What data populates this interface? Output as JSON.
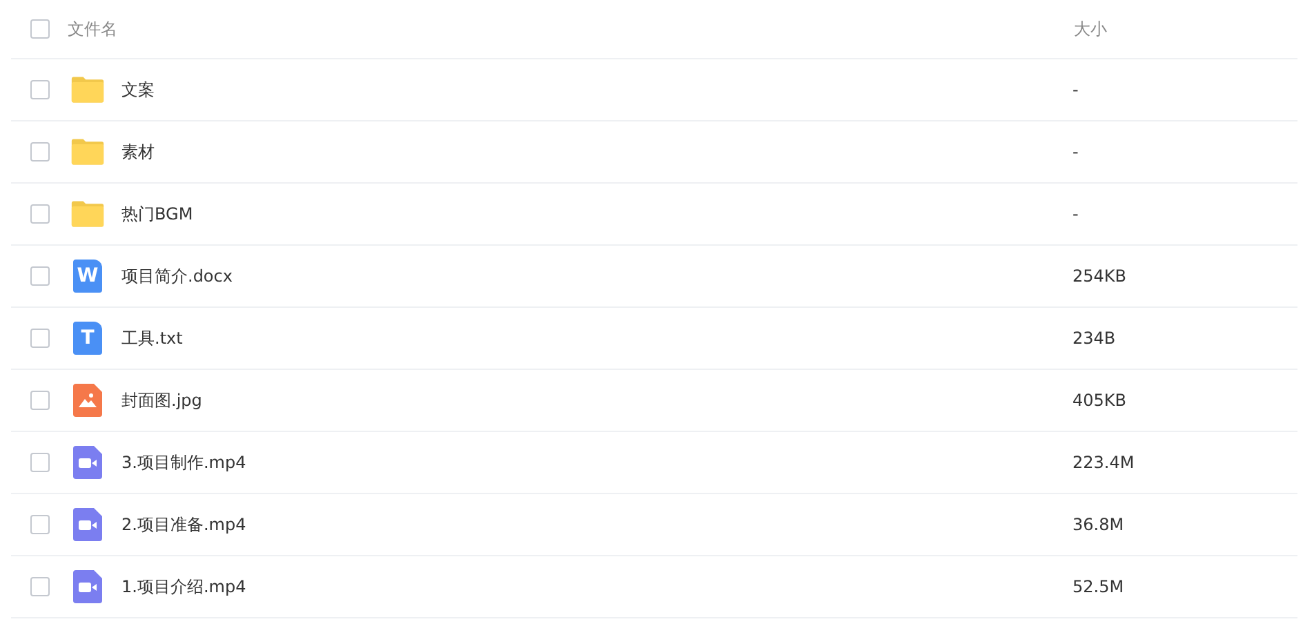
{
  "header": {
    "checked": false,
    "name": "文件名",
    "size": "大小"
  },
  "files": [
    {
      "kind": "folder",
      "name": "文案",
      "size": "-",
      "checked": false
    },
    {
      "kind": "folder",
      "name": "素材",
      "size": "-",
      "checked": false
    },
    {
      "kind": "folder",
      "name": "热门BGM",
      "size": "-",
      "checked": false
    },
    {
      "kind": "doc",
      "icon_text": "W",
      "name": "项目简介.docx",
      "size": "254KB",
      "checked": false
    },
    {
      "kind": "txt",
      "icon_text": "T",
      "name": "工具.txt",
      "size": "234B",
      "checked": false
    },
    {
      "kind": "image",
      "name": "封面图.jpg",
      "size": "405KB",
      "checked": false
    },
    {
      "kind": "video",
      "name": "3.项目制作.mp4",
      "size": "223.4M",
      "checked": false
    },
    {
      "kind": "video",
      "name": "2.项目准备.mp4",
      "size": "36.8M",
      "checked": false
    },
    {
      "kind": "video",
      "name": "1.项目介绍.mp4",
      "size": "52.5M",
      "checked": false
    }
  ]
}
